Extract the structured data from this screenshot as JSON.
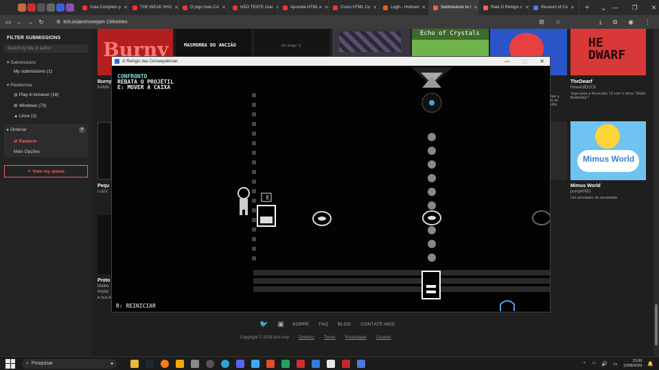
{
  "browser": {
    "tabs": [
      {
        "label": "Guia Completo p",
        "color": "#ff2f2f"
      },
      {
        "label": "THE WEAK SHO",
        "color": "#ff2f2f"
      },
      {
        "label": "O jogo mais CA",
        "color": "#ff2f2f"
      },
      {
        "label": "NÃO TENTE criar",
        "color": "#ff2f2f"
      },
      {
        "label": "Aprenda HTML e",
        "color": "#ff2f2f"
      },
      {
        "label": "Curso HTML Co",
        "color": "#ff2f2f"
      },
      {
        "label": "Login - Hotmart",
        "color": "#f05a28"
      },
      {
        "label": "Submissions to I",
        "color": "#fa5c5c",
        "active": true
      },
      {
        "label": "Rate O Relógio c",
        "color": "#fa5c5c"
      },
      {
        "label": "Museum of Co",
        "color": "#4a7bd6"
      }
    ],
    "new_tab": "+",
    "tab_close": "✕",
    "url": "itch.io/jam/nonejam-13/entries"
  },
  "sidebar": {
    "title": "FILTER SUBMISSIONS",
    "search_placeholder": "Search by title or author",
    "submissions_header": "Submissions",
    "my_submissions": "My submissions (1)",
    "platforms_header": "Plataforma",
    "platforms": [
      "Play in browser (16)",
      "Windows (73)",
      "Linux (2)"
    ],
    "sort_header": "Ordenar",
    "sort_selected": "Random",
    "more_options": "Mais Opções",
    "queue_button": "✕ View my queue"
  },
  "cards": {
    "burny": {
      "title": "Burny",
      "author": "KAMA"
    },
    "masmorra": {
      "label": "MASMORRA DO ANCIÃO"
    },
    "noimage": {
      "label": "(no image :()"
    },
    "echo": {
      "label": "Echo of Crystals"
    },
    "thedwarf": {
      "title": "TheDwarf",
      "author": "HowardDUCK",
      "desc": "Jogo para a NoneJam 13 com o tema \"Efeito Borboleta\"!",
      "art_text": "HE DWARF"
    },
    "pequ": {
      "title": "Pequ",
      "author": "LuizV"
    },
    "partial_desc": {
      "line1": "que a",
      "line2": "to de",
      "line3": "olho"
    },
    "mimus": {
      "title": "Mimus World",
      "author": "pumpKING",
      "desc": "Um simulador de sociedade",
      "art_text": "Mimus World"
    },
    "proto": {
      "title": "Proto",
      "author": "Mathe",
      "line2": "lmytat",
      "line3": "A Text A"
    }
  },
  "game_window": {
    "title": "O Relógio das Consequências",
    "hud": {
      "line1": "CONFRONTO",
      "line2": "REBATA O PROJÉTIL",
      "line3": "E: MOVER A CAIXA"
    },
    "key_hint": "E",
    "restart": "R: REINICIAR"
  },
  "footer": {
    "links": [
      "SOBRE",
      "FAQ",
      "BLOG",
      "CONTATE-NOS"
    ],
    "copyright": "Copyright © 2026 itch corp",
    "legal": [
      "Diretório",
      "Termo",
      "Privacidade",
      "Cookies"
    ]
  },
  "taskbar": {
    "search": "Pesquisar",
    "time": "23:30",
    "date": "12/08/2026"
  }
}
